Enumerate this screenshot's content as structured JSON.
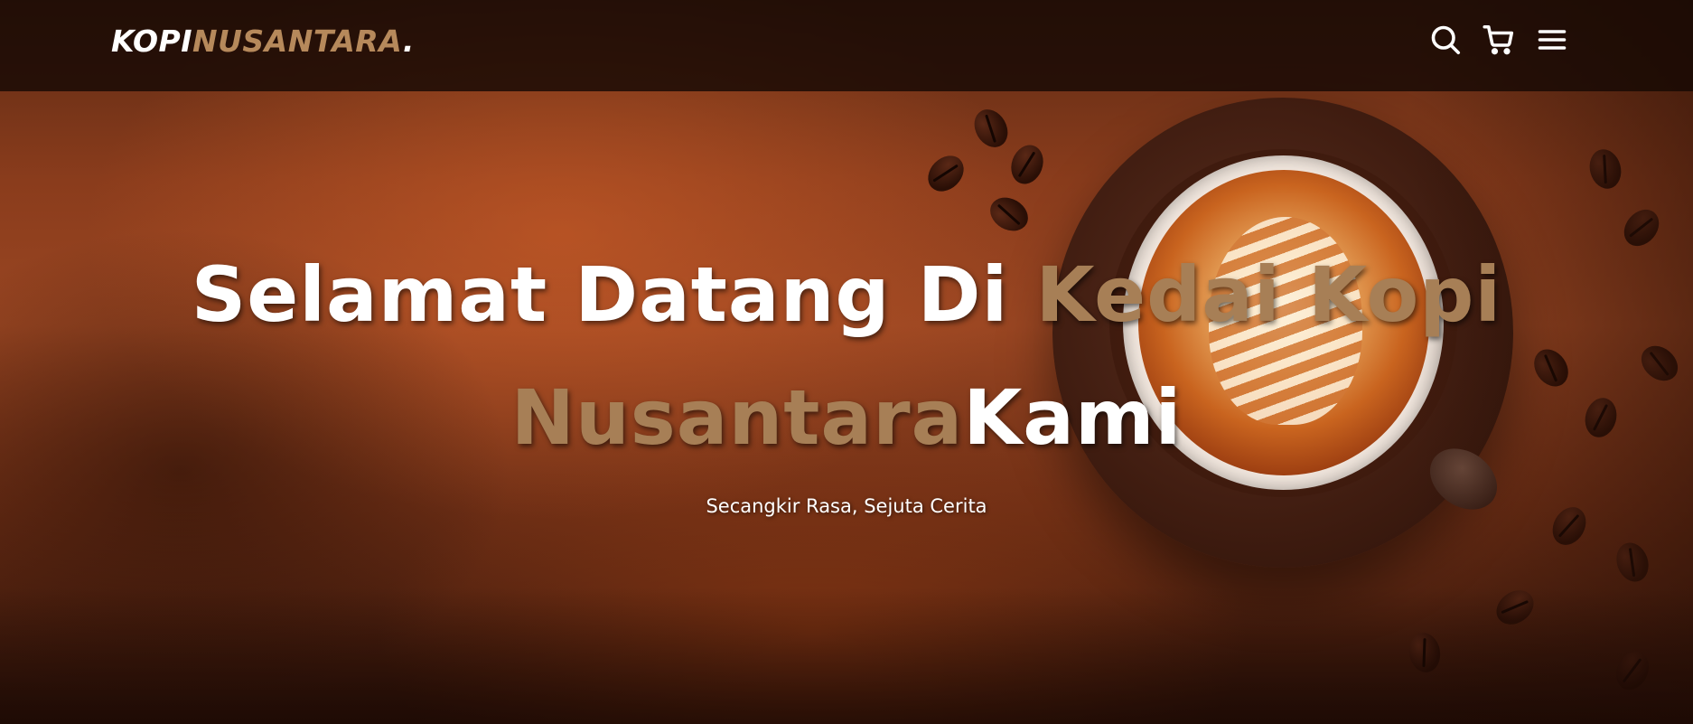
{
  "navbar": {
    "logo": {
      "part1": "KOPI",
      "part2": "NUSANTARA",
      "part3": "."
    },
    "icons": [
      {
        "name": "search-icon",
        "label": "Search"
      },
      {
        "name": "cart-icon",
        "label": "Cart"
      },
      {
        "name": "menu-icon",
        "label": "Menu"
      }
    ]
  },
  "hero": {
    "headline": {
      "line1_white": "Selamat Datang Di ",
      "line1_gold": "Kedai Kopi",
      "line2_gold": "Nusantara",
      "line2_white": "Kami"
    },
    "tagline": "Secangkir Rasa, Sejuta Cerita"
  },
  "colors": {
    "accent_gold": "#b6895b",
    "headline_gold": "#a77f56",
    "navbar_bg": "#160904",
    "text_white": "#ffffff"
  }
}
